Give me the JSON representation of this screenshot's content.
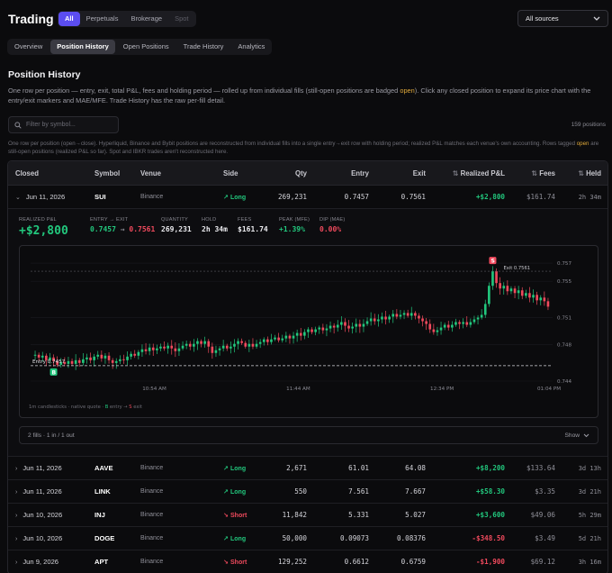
{
  "app": {
    "title": "Trading"
  },
  "source_tabs": [
    {
      "label": "All",
      "active": true,
      "disabled": false
    },
    {
      "label": "Perpetuals",
      "active": false,
      "disabled": false
    },
    {
      "label": "Brokerage",
      "active": false,
      "disabled": false
    },
    {
      "label": "Spot",
      "active": false,
      "disabled": true
    }
  ],
  "source_select": {
    "value": "All sources"
  },
  "nav_tabs": [
    {
      "label": "Overview",
      "active": false
    },
    {
      "label": "Position History",
      "active": true
    },
    {
      "label": "Open Positions",
      "active": false
    },
    {
      "label": "Trade History",
      "active": false
    },
    {
      "label": "Analytics",
      "active": false
    }
  ],
  "section": {
    "title": "Position History",
    "desc_pre": "One row per position — entry, exit, total P&L, fees and holding period — rolled up from individual fills (still-open positions are badged ",
    "desc_open": "open",
    "desc_post": "). Click any closed position to expand its price chart with the entry/exit markers and MAE/MFE. Trade History has the raw per-fill detail."
  },
  "search": {
    "placeholder": "Filter by symbol..."
  },
  "count": "159 positions",
  "note": {
    "pre": "One row per position (open→close). Hyperliquid, Binance and Bybit positions are reconstructed from individual fills into a single entry→exit row with holding period; realized P&L matches each venue's own accounting. Rows tagged ",
    "open": "open",
    "post": " are still-open positions (realized P&L so far). Spot and IBKR trades aren't reconstructed here."
  },
  "table": {
    "headers": {
      "closed": "Closed",
      "symbol": "Symbol",
      "venue": "Venue",
      "side": "Side",
      "qty": "Qty",
      "entry": "Entry",
      "exit": "Exit",
      "pnl": "Realized P&L",
      "fees": "Fees",
      "held": "Held"
    },
    "rows": [
      {
        "closed": "Jun 11, 2026",
        "symbol": "SUI",
        "venue": "Binance",
        "side": "Long",
        "qty": "269,231",
        "entry": "0.7457",
        "exit": "0.7561",
        "pnl": "+$2,800",
        "fees": "$161.74",
        "held": "2h 34m"
      },
      {
        "closed": "Jun 11, 2026",
        "symbol": "AAVE",
        "venue": "Binance",
        "side": "Long",
        "qty": "2,671",
        "entry": "61.01",
        "exit": "64.08",
        "pnl": "+$8,200",
        "fees": "$133.64",
        "held": "3d 13h"
      },
      {
        "closed": "Jun 11, 2026",
        "symbol": "LINK",
        "venue": "Binance",
        "side": "Long",
        "qty": "550",
        "entry": "7.561",
        "exit": "7.667",
        "pnl": "+$58.30",
        "fees": "$3.35",
        "held": "3d 21h"
      },
      {
        "closed": "Jun 10, 2026",
        "symbol": "INJ",
        "venue": "Binance",
        "side": "Short",
        "qty": "11,842",
        "entry": "5.331",
        "exit": "5.027",
        "pnl": "+$3,600",
        "fees": "$49.06",
        "held": "5h 29m"
      },
      {
        "closed": "Jun 10, 2026",
        "symbol": "DOGE",
        "venue": "Binance",
        "side": "Long",
        "qty": "50,000",
        "entry": "0.09073",
        "exit": "0.08376",
        "pnl": "-$348.50",
        "fees": "$3.49",
        "held": "5d 21h"
      },
      {
        "closed": "Jun 9, 2026",
        "symbol": "APT",
        "venue": "Binance",
        "side": "Short",
        "qty": "129,252",
        "entry": "0.6612",
        "exit": "0.6759",
        "pnl": "-$1,900",
        "fees": "$69.12",
        "held": "3h 16m"
      }
    ]
  },
  "detail": {
    "realized_label": "REALIZED P&L",
    "realized_value": "+$2,800",
    "entry_exit_label": "ENTRY → EXIT",
    "entry_value": "0.7457",
    "arrow": "→",
    "exit_value": "0.7561",
    "quantity_label": "QUANTITY",
    "quantity_value": "269,231",
    "hold_label": "HOLD",
    "hold_value": "2h 34m",
    "fees_label": "FEES",
    "fees_value": "$161.74",
    "peak_label": "PEAK (MFE)",
    "peak_value": "+1.39%",
    "dip_label": "DIP (MAE)",
    "dip_value": "0.00%",
    "caption_pre": "1m candlesticks · native quote · ",
    "caption_entry_marker": "B",
    "caption_mid": " entry → ",
    "caption_exit_marker": "S",
    "caption_post": " exit",
    "fills_label": "2 fills · 1 in / 1 out",
    "show_label": "Show"
  },
  "chart_data": {
    "type": "candlestick",
    "interval": "1m",
    "x_ticks": [
      "10:54 AM",
      "11:44 AM",
      "12:34 PM",
      "01:04 PM"
    ],
    "y_ticks": [
      0.757,
      0.755,
      0.751,
      0.748,
      0.744
    ],
    "ylim": [
      0.744,
      0.7575
    ],
    "entry_label": "Entry 0.7457",
    "entry_price": 0.7457,
    "entry_marker": "B",
    "exit_label": "Exit 0.7561",
    "exit_price": 0.7561,
    "exit_marker": "S",
    "peak_price": 0.7561,
    "close_series": [
      0.7469,
      0.7466,
      0.7468,
      0.7463,
      0.7466,
      0.7462,
      0.7458,
      0.7461,
      0.7459,
      0.7462,
      0.7459,
      0.7463,
      0.746,
      0.7464,
      0.7466,
      0.7463,
      0.7467,
      0.7469,
      0.7465,
      0.7468,
      0.7463,
      0.746,
      0.7462,
      0.7464,
      0.7463,
      0.7467,
      0.747,
      0.7468,
      0.7472,
      0.7475,
      0.7473,
      0.7477,
      0.7474,
      0.7476,
      0.7478,
      0.7476,
      0.7479,
      0.7476,
      0.7473,
      0.7476,
      0.7479,
      0.7481,
      0.7478,
      0.7481,
      0.7484,
      0.7481,
      0.7484,
      0.7478,
      0.7471,
      0.7474,
      0.7476,
      0.7479,
      0.7476,
      0.7478,
      0.7481,
      0.7484,
      0.7482,
      0.7478,
      0.7481,
      0.7478,
      0.7481,
      0.7483,
      0.7486,
      0.7483,
      0.7486,
      0.7488,
      0.7485,
      0.7487,
      0.749,
      0.7487,
      0.749,
      0.7493,
      0.749,
      0.7494,
      0.7497,
      0.7494,
      0.7497,
      0.7499,
      0.7496,
      0.7498,
      0.7501,
      0.7499,
      0.7502,
      0.7505,
      0.7501,
      0.7498,
      0.75,
      0.7503,
      0.75,
      0.7503,
      0.7506,
      0.7509,
      0.7506,
      0.7508,
      0.7511,
      0.7508,
      0.7511,
      0.7514,
      0.7511,
      0.7513,
      0.7515,
      0.7512,
      0.7515,
      0.7512,
      0.7509,
      0.7506,
      0.7503,
      0.7497,
      0.7494,
      0.7496,
      0.7499,
      0.7502,
      0.7499,
      0.7502,
      0.7505,
      0.7503,
      0.7505,
      0.7502,
      0.7505,
      0.7508,
      0.751,
      0.7513,
      0.7525,
      0.7545,
      0.7561,
      0.7548,
      0.7542,
      0.7545,
      0.7539,
      0.7542,
      0.7537,
      0.754,
      0.7534,
      0.7537,
      0.7532,
      0.7535,
      0.7529,
      0.7532,
      0.7528,
      0.7522
    ]
  },
  "colors": {
    "accent": "#5b4df0",
    "up": "#22c77d",
    "down": "#f04a5d",
    "highlight": "#e0a93a"
  }
}
